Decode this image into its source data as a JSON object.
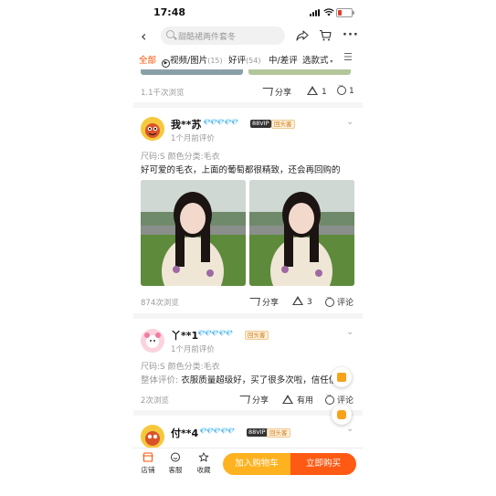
{
  "status": {
    "time": "17:48"
  },
  "search": {
    "placeholder": "甜酷裙两件套冬"
  },
  "tabs": [
    {
      "label": "全部"
    },
    {
      "label": "视频/图片",
      "count": "(15)"
    },
    {
      "label": "好评",
      "count": "(54)"
    },
    {
      "label": "中/差评"
    },
    {
      "label": "选款式"
    }
  ],
  "prev_item": {
    "views": "1.1千次浏览",
    "share": "分享",
    "likes": "1",
    "comments": "1"
  },
  "reviews": [
    {
      "user": "我**苏",
      "vip": "88VIP",
      "badge": "回头客",
      "when": "1个月前评价",
      "meta": "尺码:S 颜色分类:毛衣",
      "text": "好可爱的毛衣，上面的葡萄都很精致，还会再回购的",
      "views": "874次浏览",
      "share": "分享",
      "likes": "3",
      "comment": "评论"
    },
    {
      "user": "丫**1",
      "badge": "回头客",
      "when": "1个月前评价",
      "meta": "尺码:S 颜色分类:毛衣",
      "text_label": "整体评价:",
      "text": "衣服质量超级好，买了很多次啦，信任信",
      "views": "2次浏览",
      "share": "分享",
      "likes": "有用",
      "comment": "评论"
    },
    {
      "user": "付**4",
      "vip": "88VIP",
      "badge": "回头客"
    }
  ],
  "bottom": {
    "shop": "店铺",
    "service": "客服",
    "favorite": "收藏",
    "add_cart": "加入购物车",
    "buy_now": "立即购买"
  }
}
